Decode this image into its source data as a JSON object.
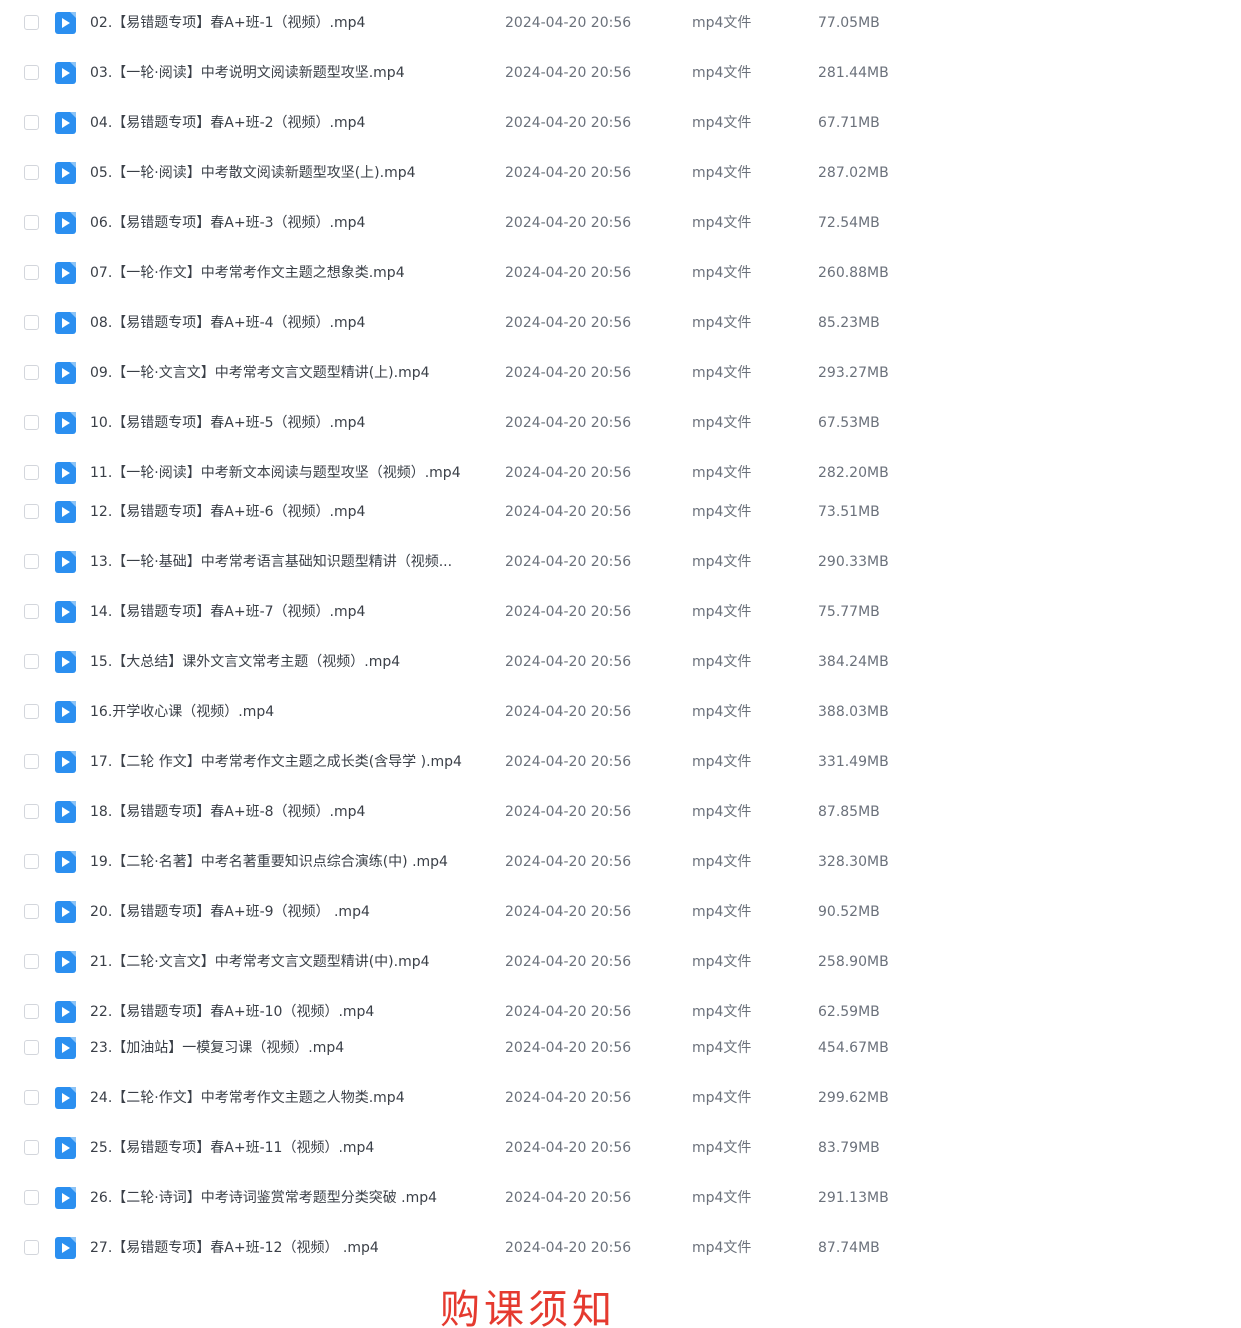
{
  "colors": {
    "icon_blue": "#2b8ff0",
    "bottom_title_red": "#e53a2f"
  },
  "icon": "video-file-icon",
  "files": [
    {
      "name": "02.【易错题专项】春A+班-1（视频）.mp4",
      "date": "2024-04-20 20:56",
      "type": "mp4文件",
      "size": "77.05MB"
    },
    {
      "name": "03.【一轮·阅读】中考说明文阅读新题型攻坚.mp4",
      "date": "2024-04-20 20:56",
      "type": "mp4文件",
      "size": "281.44MB"
    },
    {
      "name": "04.【易错题专项】春A+班-2（视频）.mp4",
      "date": "2024-04-20 20:56",
      "type": "mp4文件",
      "size": "67.71MB"
    },
    {
      "name": "05.【一轮·阅读】中考散文阅读新题型攻坚(上).mp4",
      "date": "2024-04-20 20:56",
      "type": "mp4文件",
      "size": "287.02MB"
    },
    {
      "name": "06.【易错题专项】春A+班-3（视频）.mp4",
      "date": "2024-04-20 20:56",
      "type": "mp4文件",
      "size": "72.54MB"
    },
    {
      "name": "07.【一轮·作文】中考常考作文主题之想象类.mp4",
      "date": "2024-04-20 20:56",
      "type": "mp4文件",
      "size": "260.88MB"
    },
    {
      "name": "08.【易错题专项】春A+班-4（视频）.mp4",
      "date": "2024-04-20 20:56",
      "type": "mp4文件",
      "size": "85.23MB"
    },
    {
      "name": "09.【一轮·文言文】中考常考文言文题型精讲(上).mp4",
      "date": "2024-04-20 20:56",
      "type": "mp4文件",
      "size": "293.27MB"
    },
    {
      "name": "10.【易错题专项】春A+班-5（视频）.mp4",
      "date": "2024-04-20 20:56",
      "type": "mp4文件",
      "size": "67.53MB"
    },
    {
      "name": "11.【一轮·阅读】中考新文本阅读与题型攻坚（视频）.mp4",
      "date": "2024-04-20 20:56",
      "type": "mp4文件",
      "size": "282.20MB"
    },
    {
      "name": "12.【易错题专项】春A+班-6（视频）.mp4",
      "date": "2024-04-20 20:56",
      "type": "mp4文件",
      "size": "73.51MB"
    },
    {
      "name": "13.【一轮·基础】中考常考语言基础知识题型精讲（视频...",
      "date": "2024-04-20 20:56",
      "type": "mp4文件",
      "size": "290.33MB"
    },
    {
      "name": "14.【易错题专项】春A+班-7（视频）.mp4",
      "date": "2024-04-20 20:56",
      "type": "mp4文件",
      "size": "75.77MB"
    },
    {
      "name": "15.【大总结】课外文言文常考主题（视频）.mp4",
      "date": "2024-04-20 20:56",
      "type": "mp4文件",
      "size": "384.24MB"
    },
    {
      "name": "16.开学收心课（视频）.mp4",
      "date": "2024-04-20 20:56",
      "type": "mp4文件",
      "size": "388.03MB"
    },
    {
      "name": "17.【二轮 作文】中考常考作文主题之成长类(含导学 ).mp4",
      "date": "2024-04-20 20:56",
      "type": "mp4文件",
      "size": "331.49MB"
    },
    {
      "name": "18.【易错题专项】春A+班-8（视频）.mp4",
      "date": "2024-04-20 20:56",
      "type": "mp4文件",
      "size": "87.85MB"
    },
    {
      "name": "19.【二轮·名著】中考名著重要知识点综合演练(中) .mp4",
      "date": "2024-04-20 20:56",
      "type": "mp4文件",
      "size": "328.30MB"
    },
    {
      "name": "20.【易错题专项】春A+班-9（视频） .mp4",
      "date": "2024-04-20 20:56",
      "type": "mp4文件",
      "size": "90.52MB"
    },
    {
      "name": "21.【二轮·文言文】中考常考文言文题型精讲(中).mp4",
      "date": "2024-04-20 20:56",
      "type": "mp4文件",
      "size": "258.90MB"
    },
    {
      "name": "22.【易错题专项】春A+班-10（视频）.mp4",
      "date": "2024-04-20 20:56",
      "type": "mp4文件",
      "size": "62.59MB"
    },
    {
      "name": "23.【加油站】一模复习课（视频）.mp4",
      "date": "2024-04-20 20:56",
      "type": "mp4文件",
      "size": "454.67MB"
    },
    {
      "name": "24.【二轮·作文】中考常考作文主题之人物类.mp4",
      "date": "2024-04-20 20:56",
      "type": "mp4文件",
      "size": "299.62MB"
    },
    {
      "name": "25.【易错题专项】春A+班-11（视频）.mp4",
      "date": "2024-04-20 20:56",
      "type": "mp4文件",
      "size": "83.79MB"
    },
    {
      "name": "26.【二轮·诗词】中考诗词鉴赏常考题型分类突破 .mp4",
      "date": "2024-04-20 20:56",
      "type": "mp4文件",
      "size": "291.13MB"
    },
    {
      "name": "27.【易错题专项】春A+班-12（视频） .mp4",
      "date": "2024-04-20 20:56",
      "type": "mp4文件",
      "size": "87.74MB"
    }
  ],
  "bottom_title": "购课须知"
}
